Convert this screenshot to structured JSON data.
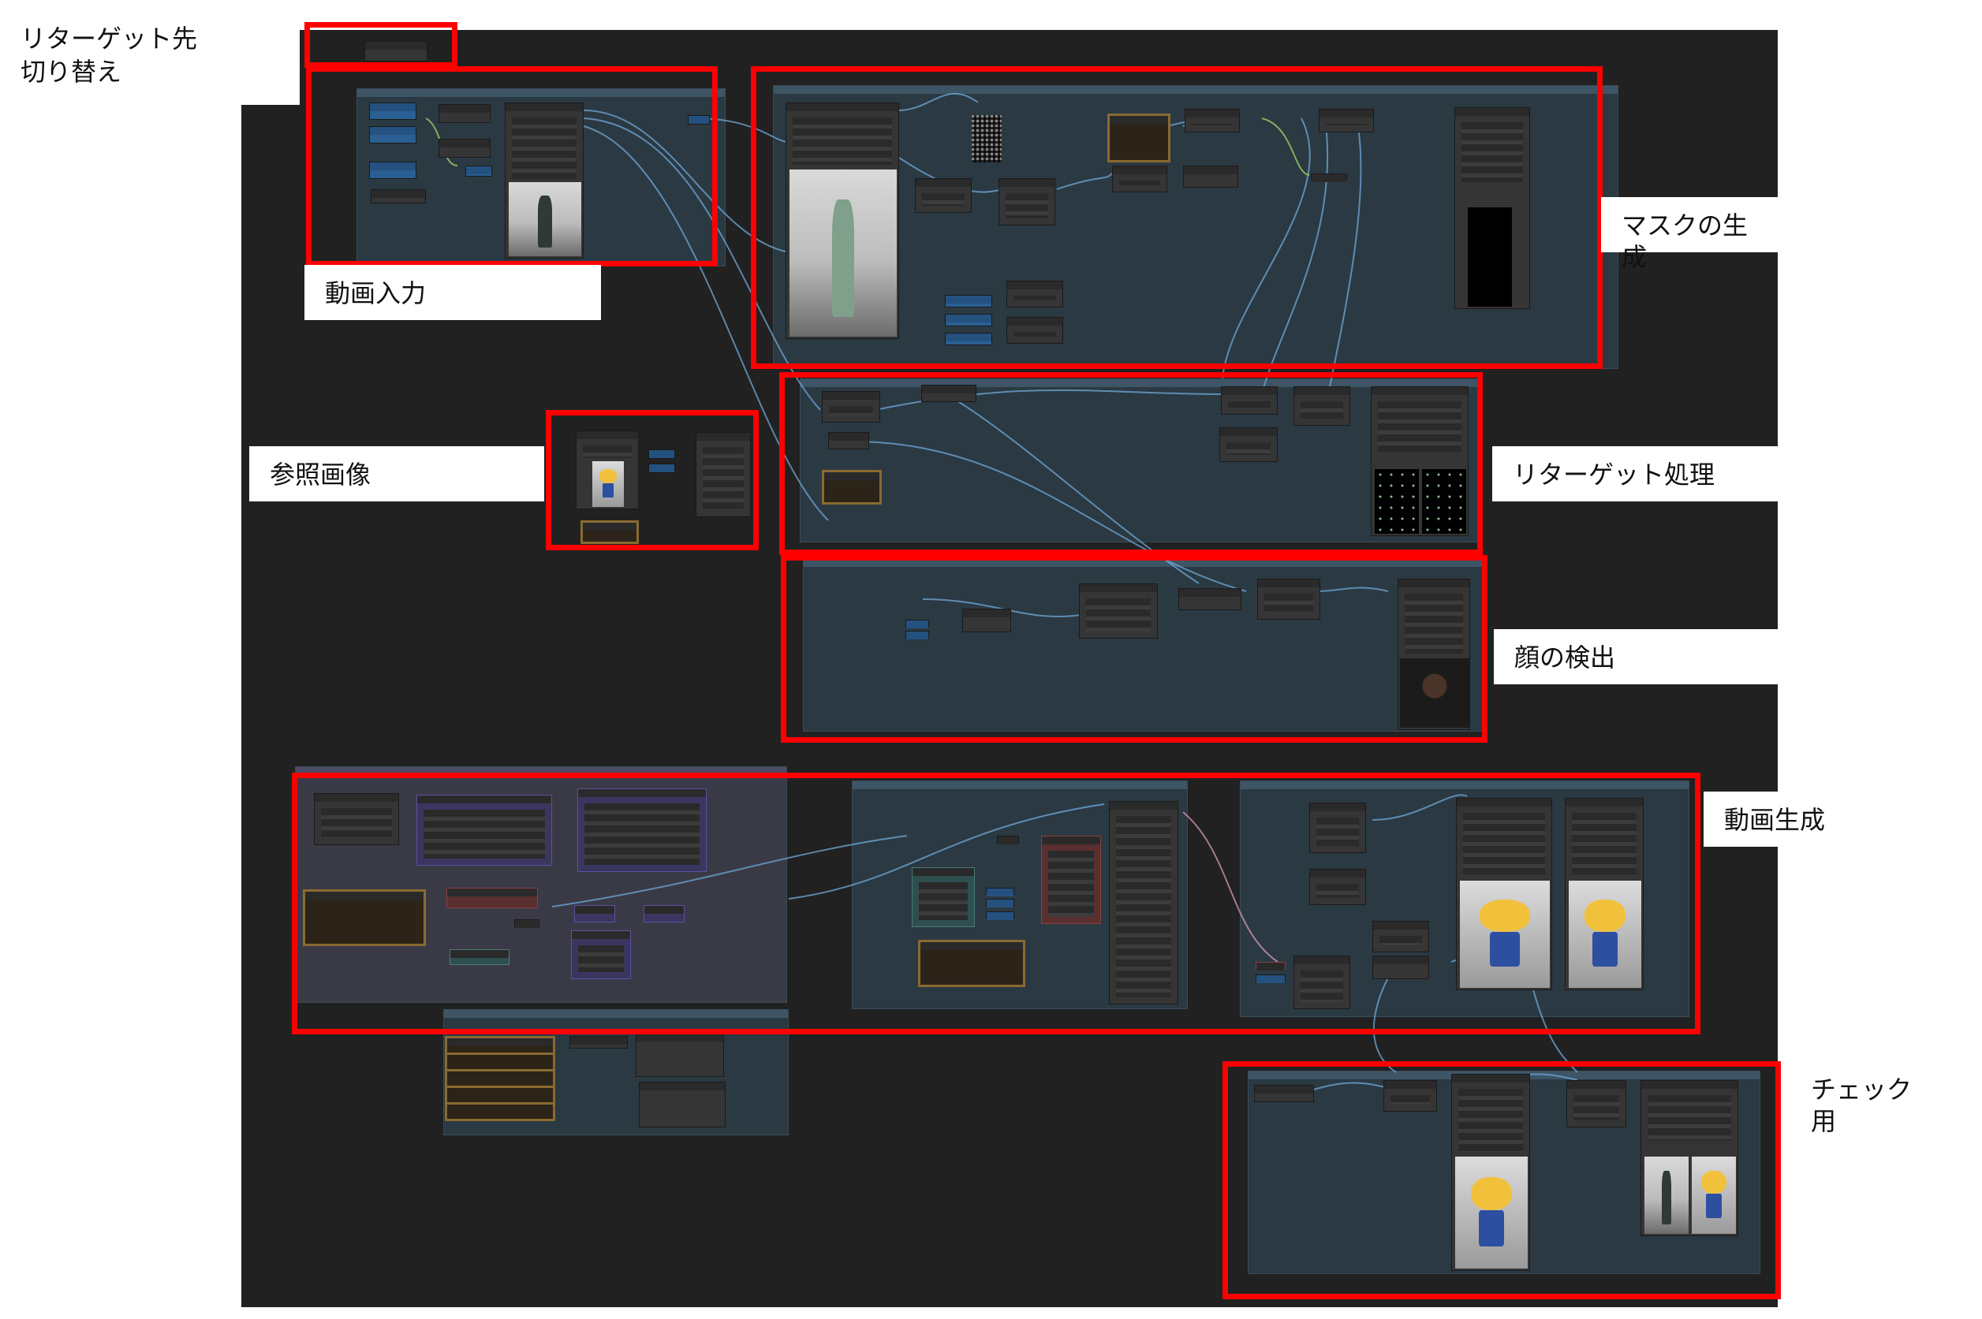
{
  "annotations": {
    "retarget_switch": "リターゲット先\n切り替え",
    "video_input": "動画入力",
    "mask_generation": "マスクの生成",
    "reference_image": "参照画像",
    "retarget_processing": "リターゲット処理",
    "face_detection": "顔の検出",
    "video_generation": "動画生成",
    "check": "チェック用"
  },
  "colors": {
    "canvas_background": "#212121",
    "group_background": "#2b3943",
    "highlight_border": "#ff0000",
    "wire_blue": "#6fa8d6",
    "wire_green": "#9ccc65",
    "wire_pink": "#e0a0c0"
  }
}
